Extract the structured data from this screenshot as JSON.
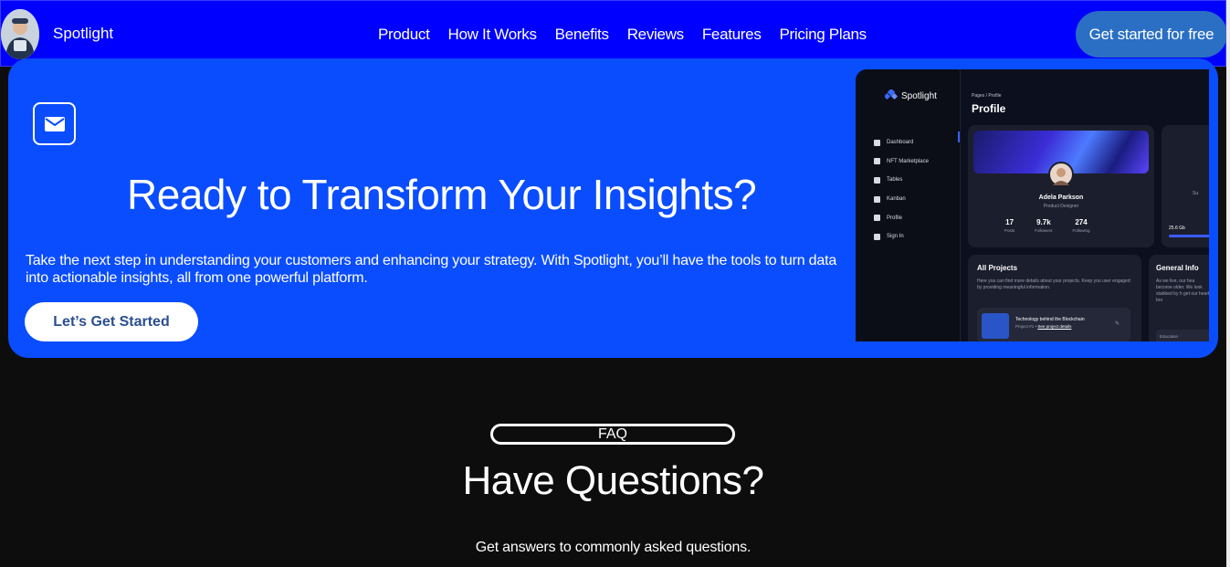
{
  "nav": {
    "brand": "Spotlight",
    "links": [
      "Product",
      "How It Works",
      "Benefits",
      "Reviews",
      "Features",
      "Pricing Plans"
    ],
    "cta": "Get started for free"
  },
  "hero": {
    "icon": "envelope-icon",
    "title": "Ready to Transform Your Insights?",
    "text": "Take the next step in understanding your customers and enhancing your strategy. With Spotlight, you’ll have the tools to turn data into actionable insights, all from one powerful platform.",
    "button": "Let’s Get Started"
  },
  "mock": {
    "logo": "Spotlight",
    "breadcrumb": "Pages / Profile",
    "title": "Profile",
    "menu": [
      "Dashboard",
      "NFT Marketplace",
      "Tables",
      "Kanban",
      "Profile",
      "Sign In"
    ],
    "profile_name": "Adela Parkson",
    "profile_role": "Product Designer",
    "stats": [
      {
        "value": "17",
        "label": "Posts"
      },
      {
        "value": "9.7k",
        "label": "Followers"
      },
      {
        "value": "274",
        "label": "Following"
      }
    ],
    "storage_hint": "Su",
    "storage_used": "25.6 Gb",
    "projects_title": "All Projects",
    "projects_text": "Here you can find more details about your projects. Keep you user engaged by providing meaningful information.",
    "project_name": "Technology behind the Blockchain",
    "project_meta": "Project #1 •",
    "project_link": "See project details",
    "general_title": "General Info",
    "general_text": "As we live, our hea become older. We look stabbed by h get our heart bro",
    "education": "Education"
  },
  "faq": {
    "pill": "FAQ",
    "title": "Have Questions?",
    "subtitle": "Get answers to commonly asked questions."
  }
}
